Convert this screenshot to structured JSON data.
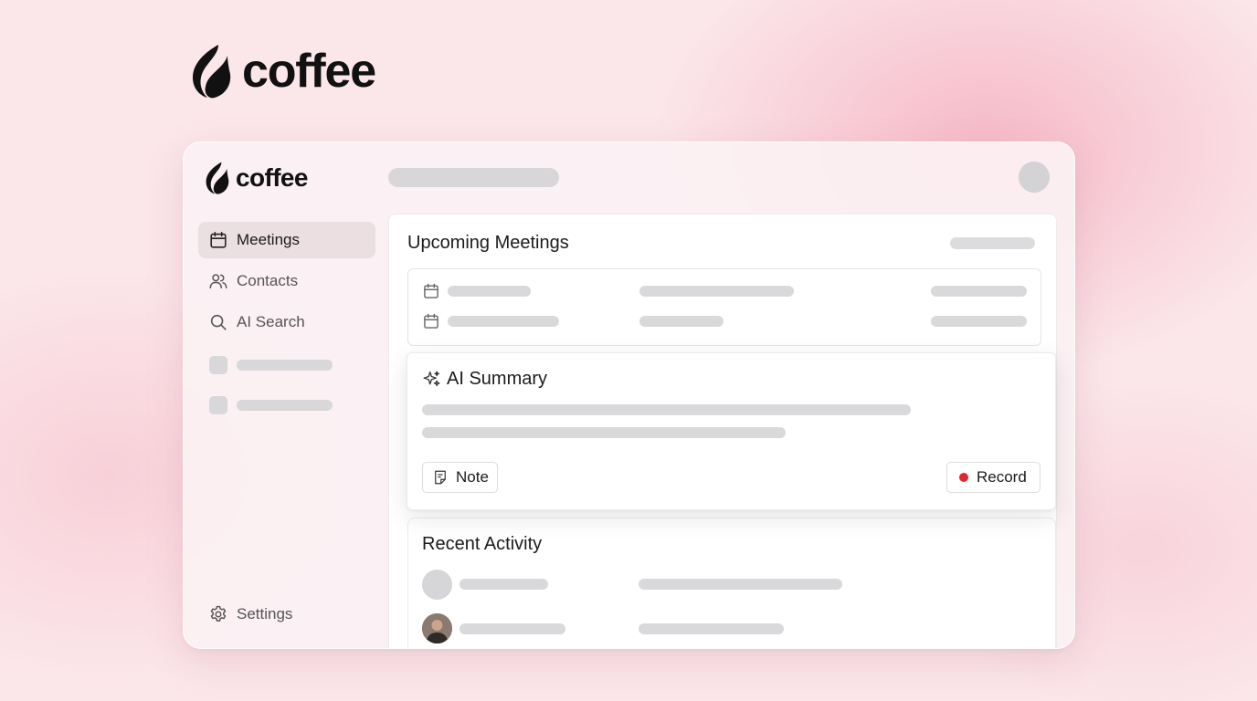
{
  "brand": {
    "name": "coffee",
    "logo_icon": "flame-leaf-logo"
  },
  "app": {
    "brand": {
      "name": "coffee"
    },
    "sidebar": {
      "items": [
        {
          "label": "Meetings",
          "icon": "calendar-icon",
          "active": true
        },
        {
          "label": "Contacts",
          "icon": "users-icon",
          "active": false
        },
        {
          "label": "AI Search",
          "icon": "search-icon",
          "active": false
        }
      ],
      "settings": {
        "label": "Settings",
        "icon": "gear-icon"
      }
    },
    "main": {
      "upcoming": {
        "title": "Upcoming Meetings"
      },
      "summary": {
        "title": "AI Summary",
        "icon": "sparkle-icon",
        "note_label": "Note",
        "record_label": "Record"
      },
      "activity": {
        "title": "Recent Activity"
      }
    }
  },
  "colors": {
    "background": "#fbe6ea",
    "accent_pink": "#f4aabc",
    "record_dot": "#e0262e",
    "placeholder": "#d9d9db"
  }
}
